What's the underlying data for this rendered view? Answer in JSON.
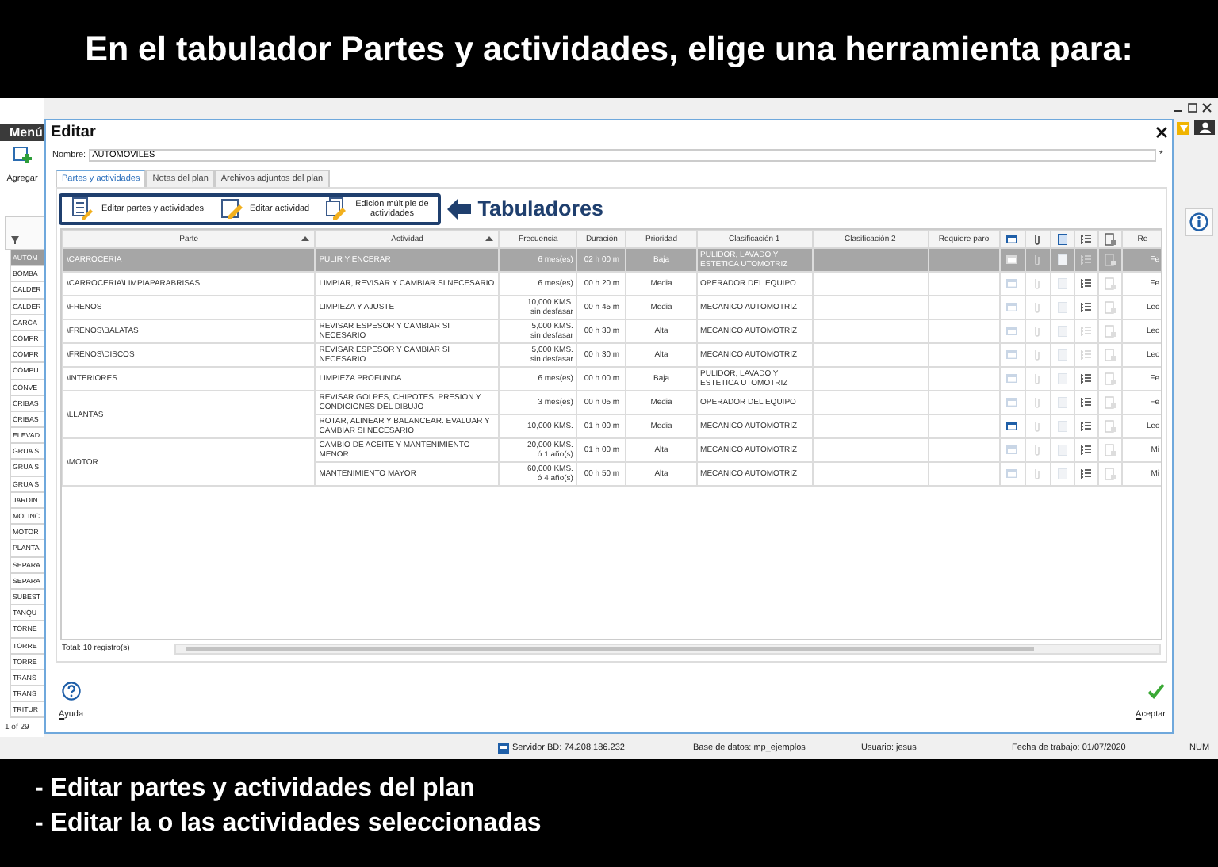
{
  "banner": {
    "title": "En el tabulador Partes y actividades, elige una herramienta para:"
  },
  "app": {
    "menu_label": "Menú",
    "add_label": "Agregar",
    "pager": "1 of 29",
    "list_items": [
      {
        "label": "AUTOM",
        "selected": true
      },
      {
        "label": "BOMBA",
        "selected": false
      },
      {
        "label": "CALDER",
        "selected": false
      },
      {
        "label": "CALDER",
        "selected": false
      },
      {
        "label": "CARCA",
        "selected": false
      },
      {
        "label": "COMPR",
        "selected": false
      },
      {
        "label": "COMPR",
        "selected": false
      },
      {
        "label": "COMPU",
        "selected": false
      },
      {
        "label": "CONVE",
        "selected": false
      },
      {
        "label": "CRIBAS",
        "selected": false
      },
      {
        "label": "CRIBAS",
        "selected": false
      },
      {
        "label": "ELEVAD",
        "selected": false
      },
      {
        "label": "GRUA S",
        "selected": false
      },
      {
        "label": "GRUA S",
        "selected": false
      },
      {
        "label": "GRUA S",
        "selected": false
      },
      {
        "label": "JARDIN",
        "selected": false
      },
      {
        "label": "MOLINC",
        "selected": false
      },
      {
        "label": "MOTOR",
        "selected": false
      },
      {
        "label": "PLANTA",
        "selected": false
      },
      {
        "label": "SEPARA",
        "selected": false
      },
      {
        "label": "SEPARA",
        "selected": false
      },
      {
        "label": "SUBEST",
        "selected": false
      },
      {
        "label": "TANQU",
        "selected": false
      },
      {
        "label": "TORNE",
        "selected": false
      },
      {
        "label": "TORRE",
        "selected": false
      },
      {
        "label": "TORRE",
        "selected": false
      },
      {
        "label": "TRANS",
        "selected": false
      },
      {
        "label": "TRANS",
        "selected": false
      },
      {
        "label": "TRITUR",
        "selected": false
      }
    ]
  },
  "dialog": {
    "title": "Editar",
    "name_label": "Nombre:",
    "name_value": "AUTOMOVILES",
    "required_mark": "*",
    "tabs": [
      {
        "label": "Partes y actividades",
        "selected": true
      },
      {
        "label": "Notas del plan",
        "selected": false
      },
      {
        "label": "Archivos adjuntos del plan",
        "selected": false
      }
    ],
    "toolbar": [
      {
        "label": "Editar partes y actividades",
        "kind": "parts"
      },
      {
        "label": "Editar actividad",
        "kind": "edit"
      },
      {
        "label": "Edición múltiple de\nactividades",
        "kind": "multi"
      }
    ],
    "annotation": {
      "label": "Tabuladores"
    },
    "table": {
      "columns": [
        {
          "kind": "text",
          "label": "Parte",
          "sorted": true
        },
        {
          "kind": "text",
          "label": "Actividad",
          "sorted": true
        },
        {
          "kind": "text",
          "label": "Frecuencia",
          "sorted": false
        },
        {
          "kind": "text",
          "label": "Duración",
          "sorted": false
        },
        {
          "kind": "text",
          "label": "Prioridad",
          "sorted": false
        },
        {
          "kind": "text",
          "label": "Clasificación 1",
          "sorted": false
        },
        {
          "kind": "text",
          "label": "Clasificación 2",
          "sorted": false
        },
        {
          "kind": "text",
          "label": "Requiere paro",
          "sorted": false
        },
        {
          "kind": "icon"
        },
        {
          "kind": "icon"
        },
        {
          "kind": "icon"
        },
        {
          "kind": "icon"
        },
        {
          "kind": "icon"
        },
        {
          "kind": "text",
          "label": "Re",
          "sorted": false
        }
      ],
      "groups": [
        {
          "parte": "\\CARROCERIA",
          "activities": [
            {
              "selected": true,
              "actividad": "PULIR Y ENCERAR",
              "frecuencia": "6 mes(es)",
              "duracion": "02 h 00 m",
              "prioridad": "Baja",
              "clasificacion_1": "PULIDOR, LAVADO Y\nESTETICA UTOMOTRIZ",
              "calendar": false,
              "checklist": false,
              "column_14": "Fe"
            }
          ]
        },
        {
          "parte": "\\CARROCERIA\\LIMPIAPARABRISAS",
          "activities": [
            {
              "selected": false,
              "actividad": "LIMPIAR, REVISAR Y CAMBIAR SI NECESARIO",
              "frecuencia": "6 mes(es)",
              "duracion": "00 h 20 m",
              "prioridad": "Media",
              "clasificacion_1": "OPERADOR DEL EQUIPO",
              "calendar": false,
              "checklist": true,
              "column_14": "Fe"
            }
          ]
        },
        {
          "parte": "\\FRENOS",
          "activities": [
            {
              "selected": false,
              "actividad": "LIMPIEZA Y AJUSTE",
              "frecuencia": "10,000 KMS.\nsin desfasar",
              "duracion": "00 h 45 m",
              "prioridad": "Media",
              "clasificacion_1": "MECANICO AUTOMOTRIZ",
              "calendar": false,
              "checklist": true,
              "column_14": "Lec"
            }
          ]
        },
        {
          "parte": "\\FRENOS\\BALATAS",
          "activities": [
            {
              "selected": false,
              "actividad": "REVISAR ESPESOR Y CAMBIAR SI NECESARIO",
              "frecuencia": "5,000 KMS.\nsin desfasar",
              "duracion": "00 h 30 m",
              "prioridad": "Alta",
              "clasificacion_1": "MECANICO AUTOMOTRIZ",
              "calendar": false,
              "checklist": false,
              "column_14": "Lec"
            }
          ]
        },
        {
          "parte": "\\FRENOS\\DISCOS",
          "activities": [
            {
              "selected": false,
              "actividad": "REVISAR ESPESOR Y CAMBIAR SI NECESARIO",
              "frecuencia": "5,000 KMS.\nsin desfasar",
              "duracion": "00 h 30 m",
              "prioridad": "Alta",
              "clasificacion_1": "MECANICO AUTOMOTRIZ",
              "calendar": false,
              "checklist": false,
              "column_14": "Lec"
            }
          ]
        },
        {
          "parte": "\\INTERIORES",
          "activities": [
            {
              "selected": false,
              "actividad": "LIMPIEZA PROFUNDA",
              "frecuencia": "6 mes(es)",
              "duracion": "00 h 00 m",
              "prioridad": "Baja",
              "clasificacion_1": "PULIDOR, LAVADO Y\nESTETICA UTOMOTRIZ",
              "calendar": false,
              "checklist": true,
              "column_14": "Fe"
            }
          ]
        },
        {
          "parte": "\\LLANTAS",
          "activities": [
            {
              "selected": false,
              "actividad": "REVISAR GOLPES, CHIPOTES, PRESION Y CONDICIONES DEL DIBUJO",
              "frecuencia": "3 mes(es)",
              "duracion": "00 h 05 m",
              "prioridad": "Media",
              "clasificacion_1": "OPERADOR DEL EQUIPO",
              "calendar": false,
              "checklist": true,
              "column_14": "Fe"
            },
            {
              "selected": false,
              "actividad": "ROTAR, ALINEAR Y BALANCEAR. EVALUAR Y CAMBIAR SI NECESARIO",
              "frecuencia": "10,000 KMS.",
              "duracion": "01 h 00 m",
              "prioridad": "Media",
              "clasificacion_1": "MECANICO AUTOMOTRIZ",
              "calendar": true,
              "checklist": true,
              "column_14": "Lec"
            }
          ]
        },
        {
          "parte": "\\MOTOR",
          "activities": [
            {
              "selected": false,
              "actividad": "CAMBIO DE ACEITE Y MANTENIMIENTO MENOR",
              "frecuencia": "20,000 KMS.\nó 1 año(s)",
              "duracion": "01 h 00 m",
              "prioridad": "Alta",
              "clasificacion_1": "MECANICO AUTOMOTRIZ",
              "calendar": false,
              "checklist": true,
              "column_14": "Mi"
            },
            {
              "selected": false,
              "actividad": "MANTENIMIENTO MAYOR",
              "frecuencia": "60,000 KMS.\nó 4 año(s)",
              "duracion": "00 h 50 m",
              "prioridad": "Alta",
              "clasificacion_1": "MECANICO AUTOMOTRIZ",
              "calendar": false,
              "checklist": true,
              "column_14": "Mi"
            }
          ]
        }
      ]
    },
    "total": "Total: 10 registro(s)",
    "help_label": "Ayuda",
    "accept_label": "Aceptar"
  },
  "status_bar": [
    {
      "label": "Servidor BD: 74.208.186.232",
      "kind": "server"
    },
    {
      "label": "Base de datos: mp_ejemplos",
      "kind": "plain"
    },
    {
      "label": "Usuario: jesus",
      "kind": "plain"
    },
    {
      "label": "Fecha de trabajo: 01/07/2020",
      "kind": "plain"
    },
    {
      "label": "NUM",
      "kind": "plain"
    }
  ],
  "footer_notes": [
    "- Editar partes y actividades del plan",
    "- Editar la o las actividades seleccionadas"
  ]
}
